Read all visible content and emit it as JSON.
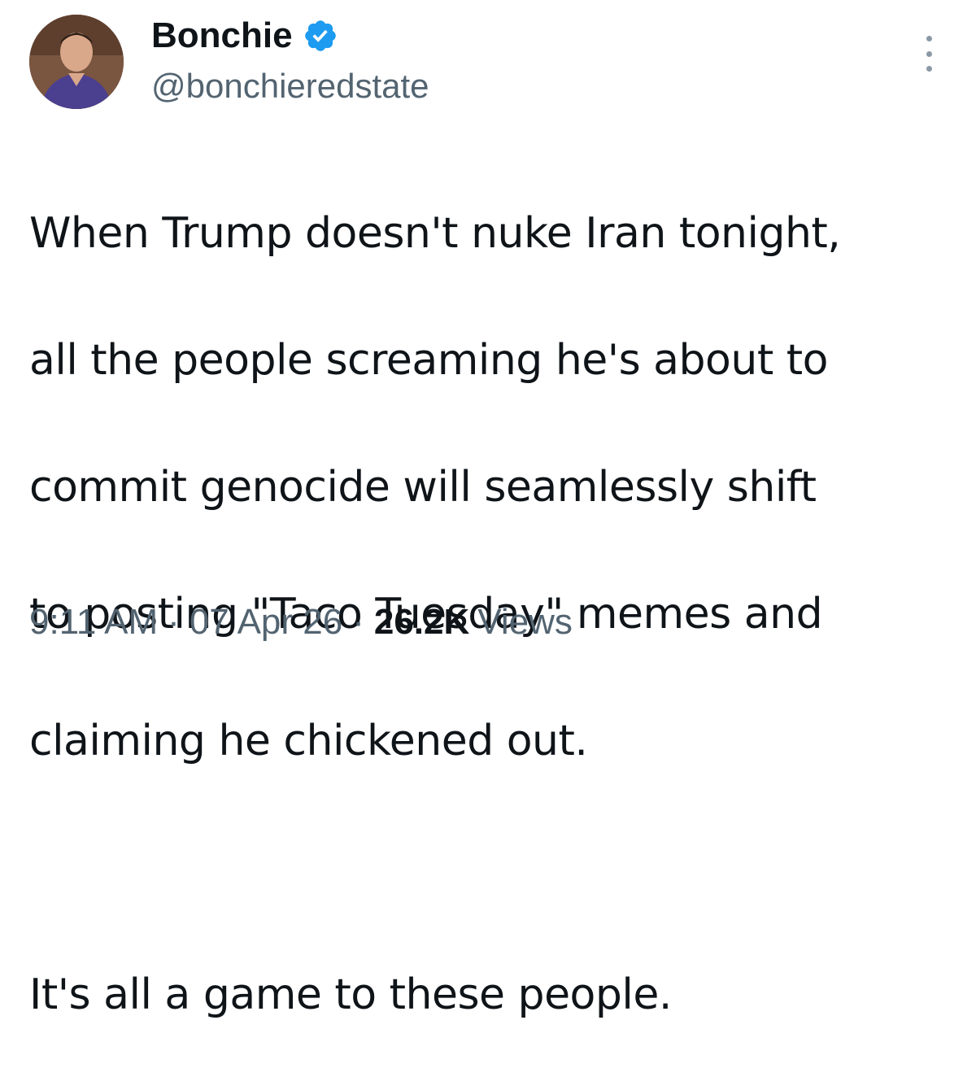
{
  "tweet": {
    "author": {
      "display_name": "Bonchie",
      "handle": "@bonchieredstate",
      "verified": true,
      "verified_color": "#1d9bf0"
    },
    "text_lines": [
      "When Trump doesn't nuke Iran tonight,",
      "all the people screaming he's about to",
      "commit genocide will seamlessly shift",
      "to posting \"Taco Tuesday\" memes and",
      "claiming he chickened out."
    ],
    "text_line_2": "It's all a game to these people.",
    "time": "9:11 AM",
    "separator": "·",
    "date": "07 Apr 26",
    "views_count": "26.2K",
    "views_label": "Views"
  },
  "icons": {
    "avatar": "avatar-photo",
    "verified": "verified-badge-icon",
    "more": "more-options-icon"
  }
}
